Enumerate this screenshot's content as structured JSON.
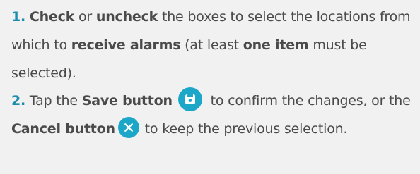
{
  "instructions": {
    "step1": {
      "number": "1.",
      "check": "Check",
      "or": " or ",
      "uncheck": "uncheck",
      "text_a": " the boxes to select the locations from which to ",
      "receive_alarms": "receive alarms",
      "text_b": " (at least ",
      "one_item": "one item",
      "text_c": " must be selected)."
    },
    "step2": {
      "number": "2.",
      "tap": " Tap the ",
      "save_button": "Save button",
      "text_a": " to confirm the changes, or the ",
      "cancel_button": "Cancel button",
      "text_b": " to keep the previous selection."
    }
  },
  "icons": {
    "save": "save-icon",
    "cancel": "close-icon"
  },
  "colors": {
    "number": "#1a8dad",
    "icon_bg": "#1ca7c9",
    "text": "#4a4a4a",
    "background": "#f1f1f1"
  }
}
